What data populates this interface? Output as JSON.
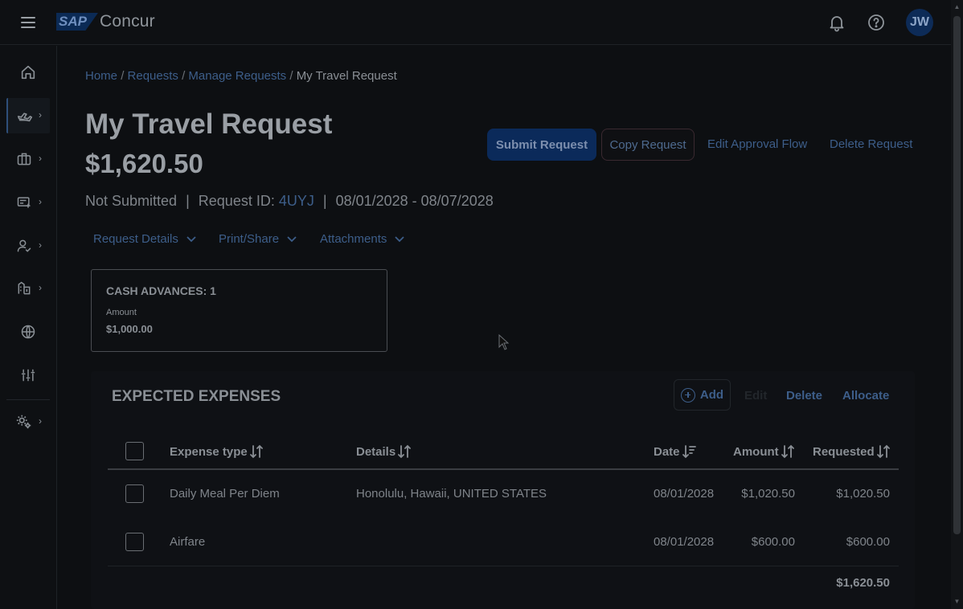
{
  "app": {
    "brand_badge": "SAP",
    "brand_name": "Concur",
    "user_initials": "JW"
  },
  "topbar_icons": [
    "menu-icon",
    "bell-icon",
    "help-icon"
  ],
  "sidebar": {
    "items": [
      {
        "name": "home",
        "icon": "home-icon",
        "has_submenu": false
      },
      {
        "name": "travel",
        "icon": "plane-icon",
        "has_submenu": true,
        "active": true
      },
      {
        "name": "trips",
        "icon": "briefcase-icon",
        "has_submenu": true
      },
      {
        "name": "expense",
        "icon": "receipt-icon",
        "has_submenu": true
      },
      {
        "name": "approvals",
        "icon": "user-check-icon",
        "has_submenu": true
      },
      {
        "name": "invoice",
        "icon": "invoice-icon",
        "has_submenu": true
      },
      {
        "name": "global",
        "icon": "globe-icon",
        "has_submenu": false
      },
      {
        "name": "reporting",
        "icon": "sliders-icon",
        "has_submenu": false
      },
      {
        "name": "admin",
        "icon": "settings-icon",
        "has_submenu": true
      }
    ]
  },
  "breadcrumb": {
    "home": "Home",
    "requests": "Requests",
    "manage": "Manage Requests",
    "current": "My Travel Request",
    "separator": "/"
  },
  "request": {
    "title": "My Travel Request",
    "amount": "$1,620.50",
    "status": "Not Submitted",
    "id_label": "Request ID:",
    "id_value": "4UYJ",
    "dates": "08/01/2028 - 08/07/2028",
    "divider": "|"
  },
  "actions": {
    "submit": "Submit Request",
    "copy": "Copy Request",
    "edit_flow": "Edit Approval Flow",
    "delete": "Delete Request"
  },
  "dropdowns": {
    "details": "Request Details",
    "print": "Print/Share",
    "attachments": "Attachments"
  },
  "cash_advances": {
    "title": "CASH ADVANCES: 1",
    "amount_label": "Amount",
    "amount": "$1,000.00"
  },
  "expenses": {
    "title": "EXPECTED EXPENSES",
    "actions": {
      "add": "Add",
      "edit": "Edit",
      "delete": "Delete",
      "allocate": "Allocate"
    },
    "columns": {
      "type": "Expense type",
      "details": "Details",
      "date": "Date",
      "amount": "Amount",
      "requested": "Requested"
    },
    "rows": [
      {
        "type": "Daily Meal Per Diem",
        "details": "Honolulu, Hawaii, UNITED STATES",
        "date": "08/01/2028",
        "amount": "$1,020.50",
        "requested": "$1,020.50"
      },
      {
        "type": "Airfare",
        "details": "",
        "date": "08/01/2028",
        "amount": "$600.00",
        "requested": "$600.00"
      }
    ],
    "total": "$1,620.50"
  },
  "colors": {
    "background": "#0d0f12",
    "link": "#3d5e8a",
    "primary_button": "#0b2a5a",
    "text": "#8a8f95"
  }
}
